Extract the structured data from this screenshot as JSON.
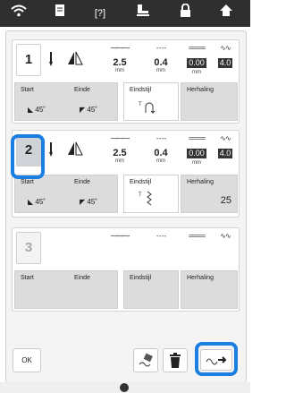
{
  "top_icons": [
    "wifi-icon",
    "document-icon",
    "help-icon",
    "presser-foot-icon",
    "lock-icon",
    "home-icon"
  ],
  "help_symbol": "[?]",
  "rows": [
    {
      "number": "1",
      "width": "2.5",
      "width_unit": "mm",
      "length": "0.4",
      "length_unit": "mm",
      "val3": "0.00",
      "val3_unit": "mm",
      "val4": "4.0",
      "start_label": "Start",
      "start_val": "45",
      "end_label": "Einde",
      "end_val": "45",
      "endstyle_label": "Eindstijl",
      "repeat_label": "Herhaling",
      "repeat_val": ""
    },
    {
      "number": "2",
      "width": "2.5",
      "width_unit": "mm",
      "length": "0.4",
      "length_unit": "mm",
      "val3": "0.00",
      "val3_unit": "mm",
      "val4": "4.0",
      "start_label": "Start",
      "start_val": "45",
      "end_label": "Einde",
      "end_val": "45",
      "endstyle_label": "Eindstijl",
      "repeat_label": "Herhaling",
      "repeat_val": "25"
    },
    {
      "number": "3",
      "start_label": "Start",
      "end_label": "Einde",
      "endstyle_label": "Eindstijl",
      "repeat_label": "Herhaling"
    }
  ],
  "buttons": {
    "ok": "OK"
  },
  "colors": {
    "accent": "#1a7fe0",
    "topbar": "#2f2f2f"
  }
}
